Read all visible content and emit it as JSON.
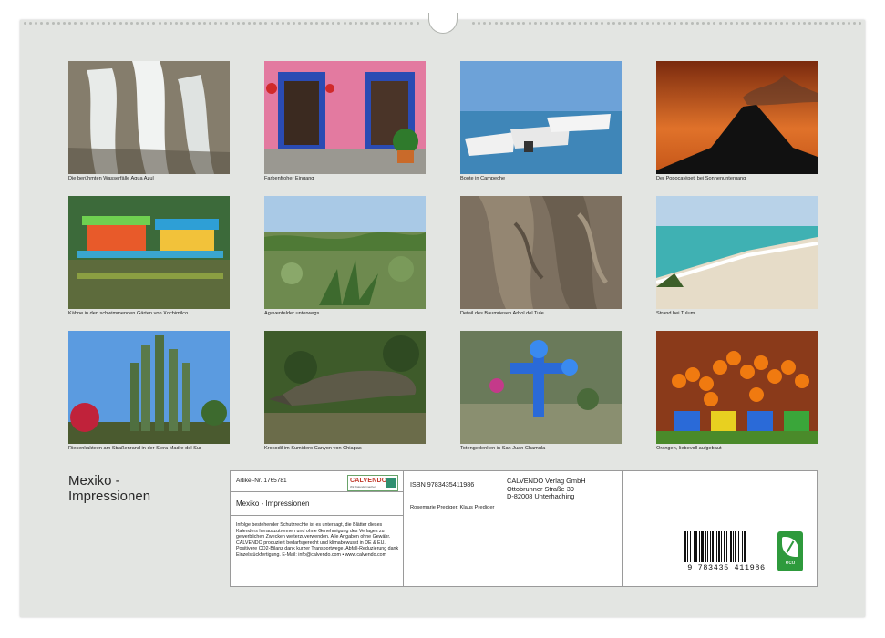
{
  "calendar": {
    "title_line1": "Mexiko -",
    "title_line2": "Impressionen"
  },
  "photos": [
    {
      "caption": "Die berühmten Wasserfälle Agua Azul",
      "subject": "waterfall"
    },
    {
      "caption": "Farbenfroher Eingang",
      "subject": "entrance"
    },
    {
      "caption": "Boote in Campeche",
      "subject": "boats"
    },
    {
      "caption": "Der Popocatépetl bei Sonnenuntergang",
      "subject": "volcano"
    },
    {
      "caption": "Kähne in den schwimmenden Gärten von Xochimilco",
      "subject": "trajineras"
    },
    {
      "caption": "Agavenfelder unterwegs",
      "subject": "agave"
    },
    {
      "caption": "Detail des Baumriesen Arbol del Tule",
      "subject": "tree"
    },
    {
      "caption": "Strand bei Tulum",
      "subject": "beach"
    },
    {
      "caption": "Riesenkakteen am Straßenrand in der Siera Madre del Sur",
      "subject": "cactus"
    },
    {
      "caption": "Krokodil im Sumidero Canyon von Chiapas",
      "subject": "crocodile"
    },
    {
      "caption": "Totengedenken in San Juan Chamula",
      "subject": "cross"
    },
    {
      "caption": "Orangen, liebevoll aufgebaut",
      "subject": "oranges"
    }
  ],
  "info": {
    "article_no": "Artikel-Nr. 1765781",
    "logo_text": "CALVENDO",
    "logo_tagline": "Wir. Kalendermacher",
    "product_title": "Mexiko - Impressionen",
    "legal_text": "Infolge bestehender Schutzrechte ist es untersagt, die Blätter dieses Kalenders herauszutrennen und ohne Genehmigung des Verlages zu gewerblichen Zwecken weiterzuverwenden. Alle Angaben ohne Gewähr. CALVENDO produziert bedarfsgerecht und klimabewusst in DE & EU. Positivere CO2-Bilanz dank kurzer Transportwege. Abfall-Reduzierung dank Einzelstückfertigung. E-Mail: info@calvendo.com • www.calvendo.com",
    "isbn": "ISBN 9783435411986",
    "authors": "Rosemarie Prediger, Klaus Prediger",
    "publisher_line1": "CALVENDO Verlag GmbH",
    "publisher_line2": "Ottobrunner Straße 39",
    "publisher_line3": "D-82008 Unterhaching",
    "barcode_number": "9 783435 411986",
    "eco_label": "eco"
  }
}
